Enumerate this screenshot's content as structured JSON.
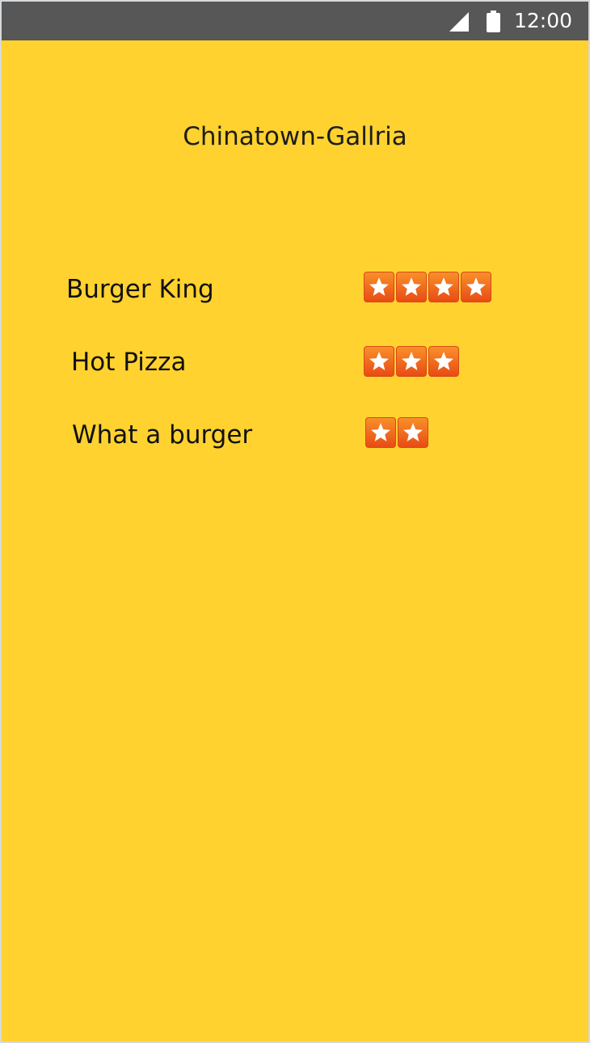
{
  "status_bar": {
    "time": "12:00",
    "signal_icon": "signal-icon",
    "battery_icon": "battery-icon"
  },
  "screen": {
    "title": "Chinatown-Gallria"
  },
  "restaurants": [
    {
      "name": "Burger King",
      "stars": 4
    },
    {
      "name": "Hot Pizza",
      "stars": 3
    },
    {
      "name": "What a burger",
      "stars": 2
    }
  ],
  "colors": {
    "background": "#ffd22f",
    "status_bar": "#575757",
    "star_tile": "#f06020"
  },
  "icons": {
    "star": "star-icon"
  }
}
